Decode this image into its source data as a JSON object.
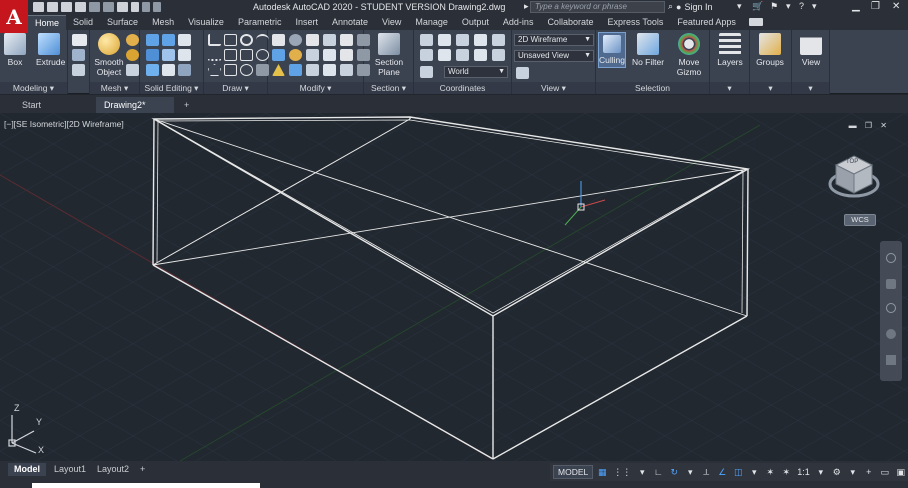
{
  "app": {
    "logo_letter": "A",
    "window_title": "Autodesk AutoCAD 2020 - STUDENT VERSION    Drawing2.dwg",
    "search_placeholder": "Type a keyword or phrase",
    "sign_in": "Sign In"
  },
  "ribbon_tabs": [
    "Home",
    "Solid",
    "Surface",
    "Mesh",
    "Visualize",
    "Parametric",
    "Insert",
    "Annotate",
    "View",
    "Manage",
    "Output",
    "Add-ins",
    "Collaborate",
    "Express Tools",
    "Featured Apps"
  ],
  "ribbon": {
    "modeling": {
      "box": "Box",
      "extrude": "Extrude",
      "label": "Modeling"
    },
    "mesh": {
      "smooth_1": "Smooth",
      "smooth_2": "Object",
      "label": "Mesh"
    },
    "solid_editing": {
      "label": "Solid Editing"
    },
    "draw": {
      "label": "Draw"
    },
    "modify": {
      "label": "Modify"
    },
    "section": {
      "btn_1": "Section",
      "btn_2": "Plane",
      "label": "Section"
    },
    "coordinates": {
      "world": "World",
      "label": "Coordinates"
    },
    "view": {
      "visual_style": "2D Wireframe",
      "saved_view": "Unsaved View",
      "label": "View"
    },
    "selection": {
      "culling": "Culling",
      "no_filter": "No Filter",
      "gizmo_1": "Move",
      "gizmo_2": "Gizmo",
      "label": "Selection"
    },
    "layers": "Layers",
    "groups": "Groups",
    "view_btn": "View"
  },
  "doc_tabs": {
    "start": "Start",
    "drawing": "Drawing2*",
    "add": "+"
  },
  "viewport": {
    "label": "[−][SE Isometric][2D Wireframe]",
    "controls": "▬ ❐ ✕",
    "wcs": "WCS",
    "cube_top": "TOP",
    "ucs_x": "X",
    "ucs_y": "Y",
    "ucs_z": "Z"
  },
  "layout_tabs": [
    "Model",
    "Layout1",
    "Layout2"
  ],
  "layout_add": "+",
  "status": {
    "model": "MODEL",
    "scale": "1:1"
  },
  "colors": {
    "background": "#212830",
    "wire": "#e8e8e8",
    "accent": "#4fa3ff",
    "logo": "#c5161d"
  }
}
